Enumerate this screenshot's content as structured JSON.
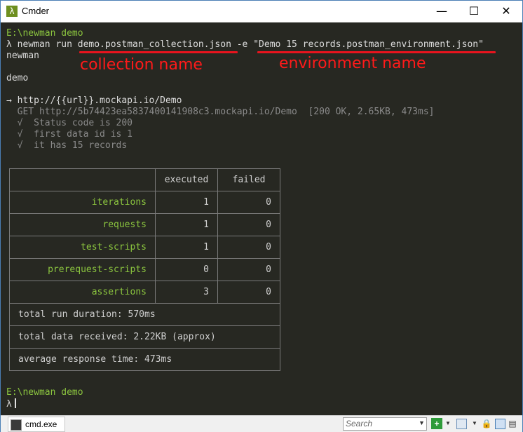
{
  "window": {
    "title": "Cmder",
    "app_icon": "λ",
    "controls": {
      "minimize": "—",
      "maximize": "☐",
      "close": "✕"
    }
  },
  "terminal": {
    "lines": [
      "E:\\newman demo",
      "λ newman run demo.postman_collection.json -e \"Demo 15 records.postman_environment.json\"",
      "newman",
      "",
      "demo",
      "",
      "→ http://{{url}}.mockapi.io/Demo",
      "  GET http://5b74423ea5837400141908c3.mockapi.io/Demo  [200 OK, 2.65KB, 473ms]",
      "  √  Status code is 200",
      "  √  first data id is 1",
      "  √  it has 15 records"
    ],
    "prompt_dir": "E:\\newman demo",
    "prompt_symbol": "λ",
    "command": {
      "prefix": "λ newman run ",
      "collection": "demo.postman_collection.json",
      "flag": " -e ",
      "environment": "\"Demo 15 records.postman_environment.json\""
    },
    "output": {
      "tool": "newman",
      "collection_name": "demo",
      "request_name": "→ http://{{url}}.mockapi.io/Demo",
      "request_detail": "  GET http://5b74423ea5837400141908c3.mockapi.io/Demo  [200 OK, 2.65KB, 473ms]",
      "tests": [
        "  √  Status code is 200",
        "  √  first data id is 1",
        "  √  it has 15 records"
      ]
    },
    "annotations": {
      "collection": "collection name",
      "environment": "environment name"
    },
    "summary_table": {
      "headers": [
        "",
        "executed",
        "failed"
      ],
      "rows": [
        {
          "label": "iterations",
          "executed": "1",
          "failed": "0"
        },
        {
          "label": "requests",
          "executed": "1",
          "failed": "0"
        },
        {
          "label": "test-scripts",
          "executed": "1",
          "failed": "0"
        },
        {
          "label": "prerequest-scripts",
          "executed": "0",
          "failed": "0"
        },
        {
          "label": "assertions",
          "executed": "3",
          "failed": "0"
        }
      ],
      "footer": [
        "total run duration: 570ms",
        "total data received: 2.22KB (approx)",
        "average response time: 473ms"
      ]
    },
    "final_prompt_dir": "E:\\newman demo",
    "final_prompt_symbol": "λ"
  },
  "statusbar": {
    "tab_label": "cmd.exe",
    "search_placeholder": "Search",
    "search_dropdown": "▼",
    "icons": [
      "plus-icon",
      "dropdown-icon",
      "console-icon",
      "dropdown-icon",
      "lock-icon",
      "layout-icon",
      "settings-icon"
    ]
  },
  "colors": {
    "background": "#272822",
    "prompt_green": "#8cc63f",
    "annotation_red": "#ff1a1a"
  }
}
